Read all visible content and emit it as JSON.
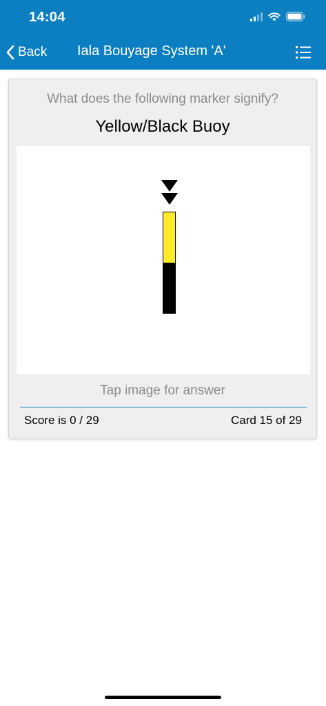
{
  "status_bar": {
    "time": "14:04"
  },
  "nav": {
    "back_label": "Back",
    "title": "Iala Bouyage System 'A'",
    "back_icon": "chevron-left-icon",
    "menu_icon": "list-icon"
  },
  "card": {
    "question": "What does the following marker signify?",
    "title": "Yellow/Black Buoy",
    "hint": "Tap image for answer",
    "score": "Score is 0 / 29",
    "card_count": "Card 15 of 29"
  },
  "marker": {
    "topmark": "two downward-pointing black cones",
    "top_color": "#ffeb2a",
    "bottom_color": "#000000"
  },
  "colors": {
    "header": "#0b7fc1",
    "card_background": "#efefef",
    "muted_text": "#8a8a8a",
    "divider": "#0b7fc1"
  }
}
